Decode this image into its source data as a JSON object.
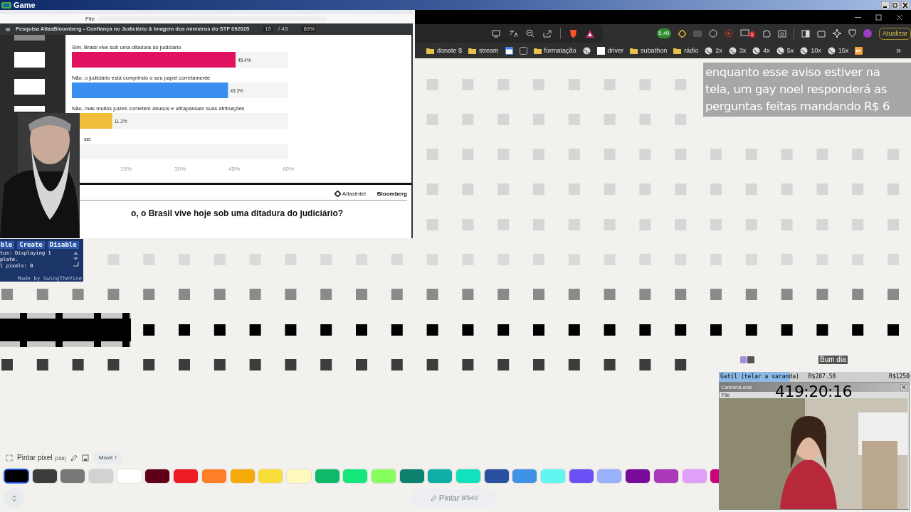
{
  "window": {
    "title": "Game"
  },
  "pdf_viewer": {
    "address_chip": "File",
    "document_title": "Pesquisa AtlasBloomberg - Confiança no Judiciário & Imagem dos ministros do STF 092025",
    "page": "15",
    "page_count": "/ 43",
    "zoom": "89%"
  },
  "poll": {
    "chart_data": {
      "type": "bar",
      "orientation": "horizontal",
      "xlim": [
        0,
        60
      ],
      "xticks": [
        {
          "value": 15,
          "label": "15%"
        },
        {
          "value": 30,
          "label": "30%"
        },
        {
          "value": 45,
          "label": "45%"
        },
        {
          "value": 60,
          "label": "60%"
        }
      ],
      "categories": [
        "Sim, Brasil vive sob uma ditadura do judiciário",
        "Não, o judiciário está cumprindo o seu papel corretamente",
        "Não, mas muitos juízes cometem abusos e ultrapassam suas atribuições"
      ],
      "series": [
        {
          "color": "#e0115f",
          "values": [
            45.4,
            null,
            null
          ]
        },
        {
          "color": "#3b8ff0",
          "values": [
            null,
            43.3,
            null
          ]
        },
        {
          "color": "#f1bd38",
          "values": [
            null,
            null,
            11.2
          ]
        }
      ],
      "value_labels": [
        "45.4%",
        "43.3%",
        "11.2%"
      ]
    },
    "partial_option": "sei"
  },
  "next_slide": {
    "brands": [
      "AtlasIntel",
      "Bloomberg"
    ],
    "question": "o, o Brasil vive hoje sob uma ditadura do judiciário?"
  },
  "browser": {
    "update_button": "Atualizar",
    "wallet_badge": "5,40",
    "notification_badge": "1",
    "bookmarks": [
      {
        "kind": "folder",
        "label": "donate $"
      },
      {
        "kind": "folder",
        "label": "stream"
      },
      {
        "kind": "calendar"
      },
      {
        "kind": "site"
      },
      {
        "kind": "folder",
        "label": "formatação"
      },
      {
        "kind": "globe"
      },
      {
        "kind": "page",
        "label": "driver"
      },
      {
        "kind": "folder",
        "label": "subathon"
      },
      {
        "kind": "folder",
        "label": "rádio"
      },
      {
        "kind": "globe",
        "label": "2x"
      },
      {
        "kind": "globe",
        "label": "3x"
      },
      {
        "kind": "globe",
        "label": "4x"
      },
      {
        "kind": "globe",
        "label": "5x"
      },
      {
        "kind": "globe",
        "label": "10x"
      },
      {
        "kind": "globe",
        "label": "15x"
      },
      {
        "kind": "forward"
      }
    ],
    "overflow": "»"
  },
  "overlay_notice": {
    "lines": [
      "enquanto esse aviso estiver na",
      "tela, um gay noel responderá as",
      "perguntas feitas mandando R$ 6"
    ]
  },
  "script_panel": {
    "buttons": [
      "ble",
      "Create",
      "Disable"
    ],
    "status_lines": [
      "tus: Displaying 1",
      "plate.",
      "l pixels: 0"
    ],
    "credit": "Made by SwingTheVine"
  },
  "chat": {
    "message": "Bum dia"
  },
  "goal": {
    "label": "Gatil (telar a varanda)",
    "current": "R$287.58",
    "target": "R$1250",
    "level": 0.37
  },
  "camera_window": {
    "title": "Camera.exe",
    "menu": [
      "File"
    ],
    "timer": "419:20:16"
  },
  "paint_toolbar": {
    "title": "Pintar pixel",
    "count": "(166)",
    "move_button": "Move ↑",
    "paint_button": "Pintar",
    "paint_count": "8/640",
    "palette": [
      {
        "color": "#000000",
        "selected": true
      },
      {
        "color": "#3c3c3c",
        "selected": false
      },
      {
        "color": "#787878",
        "selected": false
      },
      {
        "color": "#d2d2d2",
        "selected": false
      },
      {
        "color": "#ffffff",
        "selected": false
      },
      {
        "color": "#600018",
        "selected": false
      },
      {
        "color": "#ed1c24",
        "selected": false
      },
      {
        "color": "#ff7f27",
        "selected": false
      },
      {
        "color": "#f6aa09",
        "selected": false
      },
      {
        "color": "#f9dd3b",
        "selected": false
      },
      {
        "color": "#fffabc",
        "selected": false
      },
      {
        "color": "#0eb968",
        "selected": false
      },
      {
        "color": "#13e67b",
        "selected": false
      },
      {
        "color": "#87ff5e",
        "selected": false
      },
      {
        "color": "#0c816e",
        "selected": false
      },
      {
        "color": "#10aea6",
        "selected": false
      },
      {
        "color": "#13e1be",
        "selected": false
      },
      {
        "color": "#28509e",
        "selected": false
      },
      {
        "color": "#4093e4",
        "selected": false
      },
      {
        "color": "#60f7f2",
        "selected": false
      },
      {
        "color": "#6b50f6",
        "selected": false
      },
      {
        "color": "#99b1fb",
        "selected": false
      },
      {
        "color": "#780c99",
        "selected": false
      },
      {
        "color": "#aa38b9",
        "selected": false
      },
      {
        "color": "#e09ff9",
        "selected": false
      },
      {
        "color": "#cb007a",
        "selected": false
      }
    ]
  }
}
